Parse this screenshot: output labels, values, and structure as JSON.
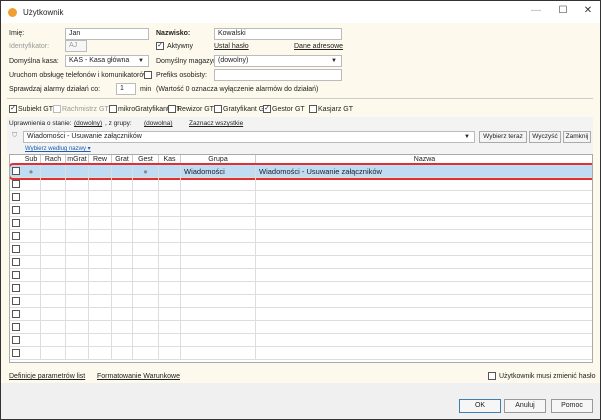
{
  "window": {
    "title": "Użytkownik",
    "minimize": "—",
    "maximize": "☐",
    "close": "✕"
  },
  "form": {
    "first_name_label": "Imię:",
    "first_name": "Jan",
    "last_name_label": "Nazwisko:",
    "last_name": "Kowalski",
    "id_label": "Identyfikator:",
    "id": "AJ",
    "active_label": "Aktywny",
    "active": true,
    "set_password": "Ustal hasło",
    "address": "Dane adresowe",
    "cashbox_label": "Domyślna kasa:",
    "cashbox": "KAS - Kasa główna",
    "warehouse_label": "Domyślny magazyn:",
    "warehouse": "(dowolny)",
    "phone_label": "Uruchom obsługę telefonów i komunikatorów",
    "prefix_label": "Prefiks osobisty:",
    "prefix": "",
    "alarm_label": "Sprawdzaj alarmy działań co:",
    "alarm": "1",
    "alarm_unit": "min",
    "alarm_note": "(Wartość 0 oznacza wyłączenie alarmów do działań)"
  },
  "apps": [
    {
      "label": "Subiekt GT",
      "checked": true,
      "disabled": false
    },
    {
      "label": "Rachmistrz GT",
      "checked": false,
      "disabled": true
    },
    {
      "label": "mikroGratyfikant GT",
      "checked": false,
      "disabled": false
    },
    {
      "label": "Rewizor GT",
      "checked": false,
      "disabled": false
    },
    {
      "label": "Gratyfikant GT",
      "checked": false,
      "disabled": false
    },
    {
      "label": "Gestor GT",
      "checked": true,
      "disabled": false
    },
    {
      "label": "Kasjarz GT",
      "checked": false,
      "disabled": false
    }
  ],
  "filter": {
    "state_label": "Uprawnienia o stanie:",
    "state": "(dowolny)",
    "group_label": ", z grupy:",
    "group": "(dowolna)",
    "select_all": "Zaznacz wszystkie",
    "search": "Wiadomości - Usuwanie załączników",
    "select_now": "Wybierz teraz",
    "clear": "Wyczyść",
    "close": "Zamknij",
    "by_name": "Wybierz według nazwy ▾"
  },
  "grid": {
    "columns": [
      "Sub",
      "Rach",
      "mGrat",
      "Rew",
      "Grat",
      "Gest",
      "Kas",
      "Grupa",
      "Nazwa"
    ],
    "rows": [
      {
        "sub": "●",
        "rach": "",
        "mgrat": "",
        "rew": "",
        "grat": "",
        "gest": "●",
        "kas": "",
        "grupa": "Wiadomości",
        "nazwa": "Wiadomości - Usuwanie załączników"
      }
    ]
  },
  "footer": {
    "param_defs": "Definicje parametrów list",
    "cond_format": "Formatowanie Warunkowe",
    "must_change": "Użytkownik musi zmienić hasło",
    "ok": "OK",
    "cancel": "Anuluj",
    "help": "Pomoc"
  }
}
